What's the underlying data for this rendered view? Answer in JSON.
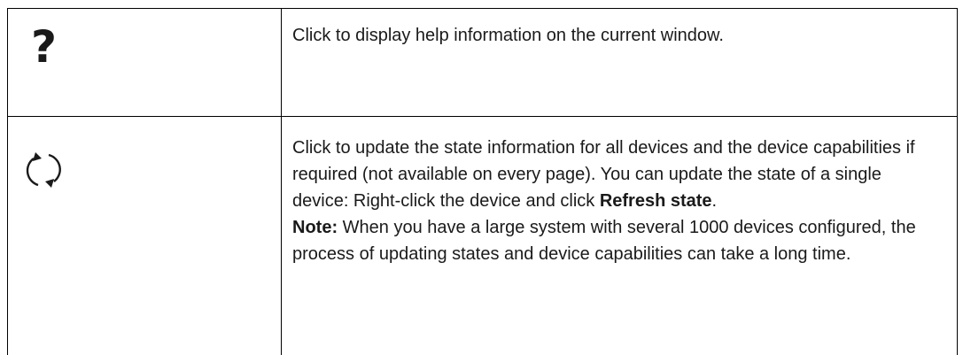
{
  "rows": [
    {
      "icon": "help-icon",
      "icon_glyph": "?",
      "text": "Click to display help information on the current window."
    },
    {
      "icon": "refresh-icon",
      "text_before": "Click to update the state information for all devices and the device capabilities if required (not available on every page). You can update the state of a single device: Right-click the device and click ",
      "bold_term": "Refresh state",
      "text_after": ".",
      "note_label": "Note:",
      "note_text": " When you have a large system with several 1000 devices configured, the process of updating states and device capabilities can take a long time."
    }
  ]
}
